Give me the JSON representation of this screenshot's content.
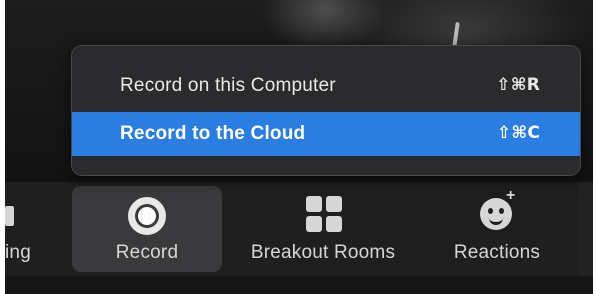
{
  "record_menu": {
    "items": [
      {
        "label": "Record on this Computer",
        "shortcut": "⇧⌘R",
        "selected": false
      },
      {
        "label": "Record to the Cloud",
        "shortcut": "⇧⌘C",
        "selected": true
      }
    ],
    "highlight_color": "#2a7de1"
  },
  "toolbar": {
    "partial_label": "ing",
    "record_label": "Record",
    "breakout_label": "Breakout Rooms",
    "reactions_label": "Reactions",
    "reactions_badge": "+",
    "icons": {
      "partial": "partial-icon",
      "record": "record-icon",
      "breakout": "grid-icon",
      "reactions": "smile-plus-icon"
    }
  }
}
